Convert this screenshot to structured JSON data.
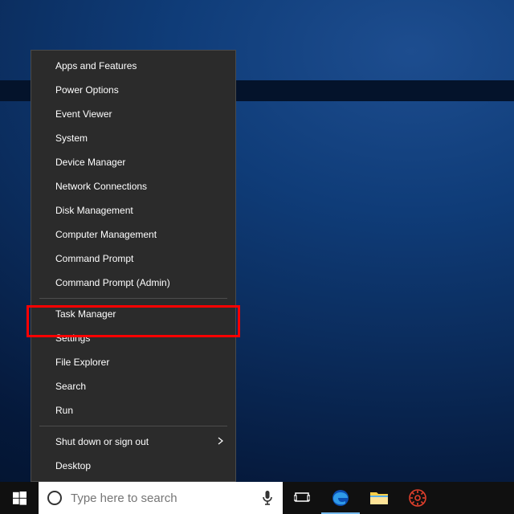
{
  "winx": {
    "group1": [
      {
        "label": "Apps and Features"
      },
      {
        "label": "Power Options"
      },
      {
        "label": "Event Viewer"
      },
      {
        "label": "System"
      },
      {
        "label": "Device Manager"
      },
      {
        "label": "Network Connections"
      },
      {
        "label": "Disk Management"
      },
      {
        "label": "Computer Management"
      },
      {
        "label": "Command Prompt"
      },
      {
        "label": "Command Prompt (Admin)"
      }
    ],
    "group2": [
      {
        "label": "Task Manager"
      },
      {
        "label": "Settings"
      },
      {
        "label": "File Explorer"
      },
      {
        "label": "Search"
      },
      {
        "label": "Run"
      }
    ],
    "group3": [
      {
        "label": "Shut down or sign out",
        "submenu": true
      },
      {
        "label": "Desktop"
      }
    ]
  },
  "taskbar": {
    "search_placeholder": "Type here to search"
  },
  "annotation": {
    "highlighted_item": "Settings"
  }
}
